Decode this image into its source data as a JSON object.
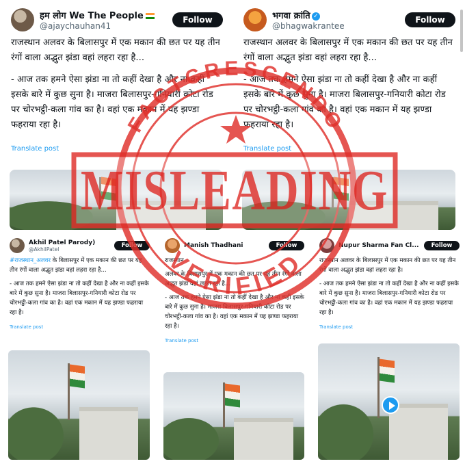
{
  "posts": [
    {
      "name": "हम लोग We The People",
      "handle": "@ajaychauhan41",
      "follow": "Follow",
      "lead": "राजस्थान अलवर के बिलासपुर में एक मकान की छत पर यह तीन रंगों वाला अद्भुत झंडा वहां लहरा रहा है...",
      "body": "- आज तक हमने ऐसा झंडा ना तो कहीं देखा है और ना कहीं इसके बारे में कुछ सुना है। माजरा बिलासपुर-गनियारी कोटा रोड पर चोरभट्ठी-कला गांव का है। वहां एक मकान में यह झण्डा फहराया रहा है।",
      "translate": "Translate post"
    },
    {
      "name": "भगवा क्रांति",
      "handle": "@bhagwakrantee",
      "follow": "Follow",
      "lead": "राजस्थान अलवर के बिलासपुर में एक मकान की छत पर यह तीन रंगों वाला अद्भुत झंडा वहां लहरा रहा है...",
      "body": "- आज तक हमने ऐसा झंडा ना तो कहीं देखा है और ना कहीं इसके बारे में कुछ सुना है। माजरा बिलासपुर-गनियारी कोटा रोड पर चोरभट्ठी-कला गांव का है। वहां एक मकान में यह झण्डा फहराया रहा है।",
      "translate": "Translate post"
    },
    {
      "name": "Akhil Patel",
      "name_suffix": "Parody)",
      "handle": "@AkhilPatel",
      "follow": "Follow",
      "lead_link": "#राजस्थान_अलवर",
      "lead": " के बिलासपुर में एक मकान की छत पर यह तीन रंगों वाला अद्भुत झंडा वहां लहरा रहा है...",
      "body": "- आज तक हमने ऐसा झंडा ना तो कहीं देखा है और ना कहीं इसके बारे में कुछ सुना है। माजरा बिलासपुर-गनियारी कोटा रोड पर चोरभट्ठी-कला गांव का है। वहां एक मकान में यह झण्डा फहराया रहा है।",
      "translate": "Translate post"
    },
    {
      "name": "Manish Thadhani",
      "handle": "",
      "follow": "Follow",
      "lead": "राजस्थान",
      "lead2": "अलवर के बिलासपुर में एक मकान की छत पर यह तीन रंगों वाला अद्भुत झंडा वहां लहरा रहा है...",
      "body": "- आज तक हमने ऐसा झंडा ना तो कहीं देखा है और ना कहीं इसके बारे में कुछ सुना है। माजरा बिलासपुर-गनियारी कोटा रोड पर चोरभट्ठी-कला गांव का है। वहां एक मकान में यह झण्डा फहराया रहा है।",
      "translate": "Translate post"
    },
    {
      "name": "Nupur Sharma Fan Cl...",
      "handle": "",
      "follow": "Follow",
      "lead": "राजस्थान अलवर के बिलासपुर में एक मकान की छत पर यह तीन रंगों वाला अद्भुत झंडा वहां लहरा रहा है।",
      "body": "- आज तक हमने ऐसा झंडा ना तो कहीं देखा है और ना कहीं इसके बारे में कुछ सुना है। माजरा बिलासपुर-गनियारी कोटा रोड पर चोरभट्ठी-कला गांव का है। वहां एक मकान में यह झण्डा फहराया रहा है।",
      "translate": "Translate post"
    }
  ],
  "stamp": {
    "word": "MISLEADING",
    "ring_top": "FACTCRESCENDO",
    "ring_bottom": "VERIFIED",
    "color": "#e0302b"
  }
}
